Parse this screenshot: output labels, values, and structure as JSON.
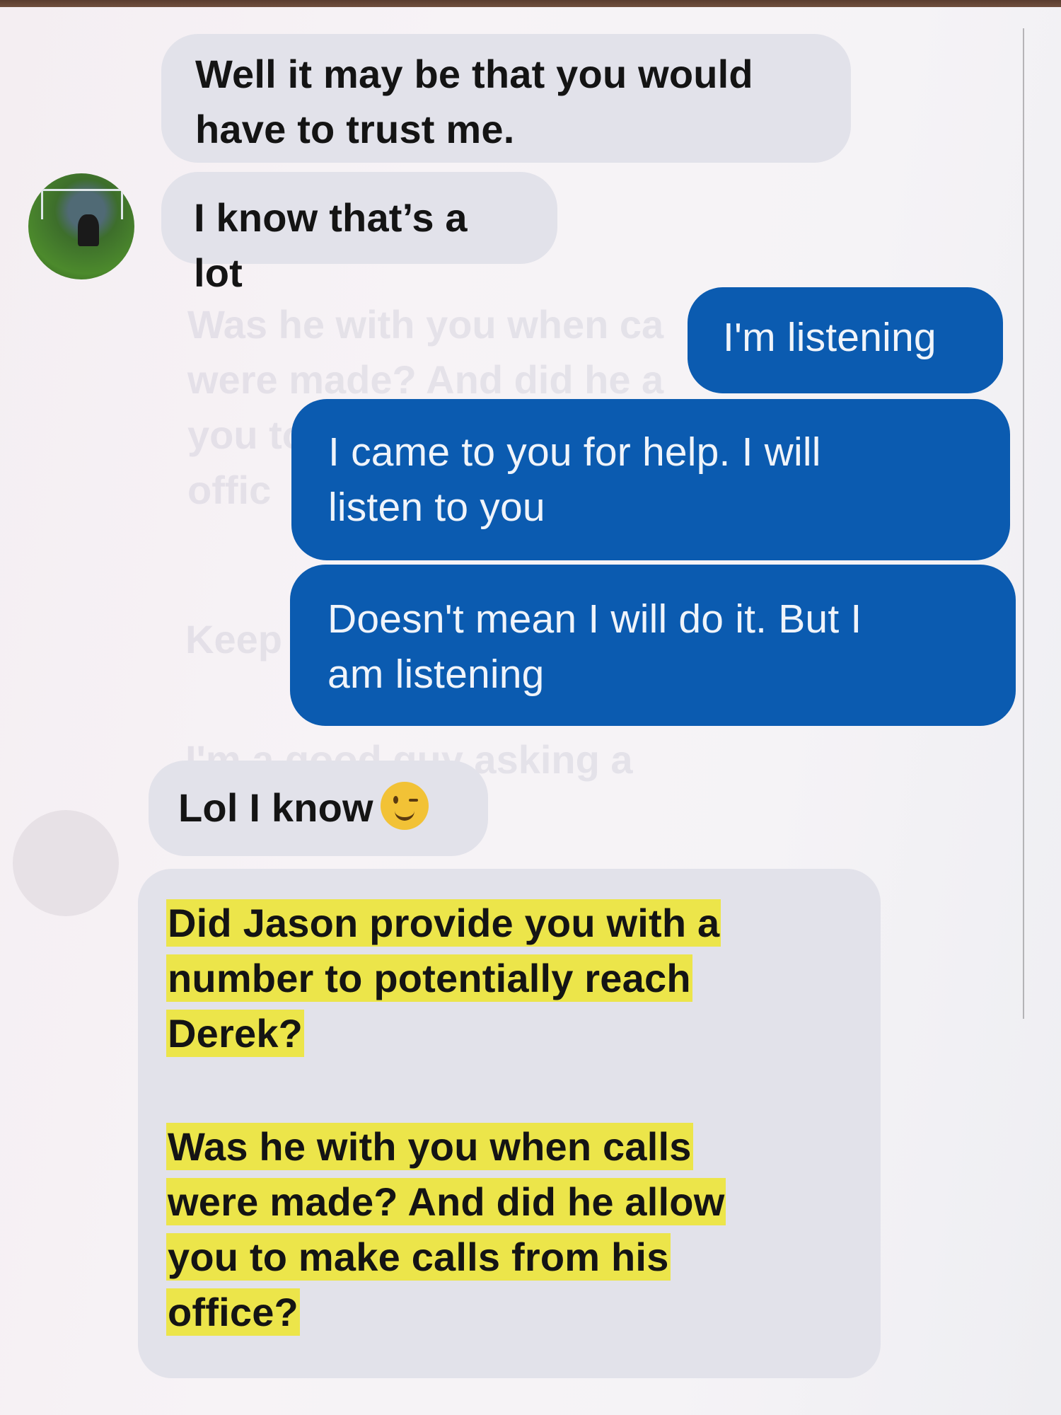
{
  "conversation": {
    "messages": [
      {
        "direction": "incoming",
        "lines": [
          "Well it may be that you would",
          "have to trust me."
        ]
      },
      {
        "direction": "incoming",
        "lines": [
          "I know that’s a lot"
        ]
      },
      {
        "direction": "outgoing",
        "lines": [
          "I'm listening"
        ]
      },
      {
        "direction": "outgoing",
        "lines": [
          "I came to you for help.  I will",
          "listen to you"
        ]
      },
      {
        "direction": "outgoing",
        "lines": [
          "Doesn't mean I will do it.  But I",
          "am listening"
        ]
      },
      {
        "direction": "incoming",
        "text": "Lol I know",
        "emoji": "winking-smile-emoji"
      },
      {
        "direction": "incoming",
        "highlighted": true,
        "highlight_color": "#ece54a",
        "paragraphs": [
          [
            "Did Jason provide you with a",
            "number to potentially reach",
            "Derek?"
          ],
          [
            "Was he with you when calls",
            "were made? And did he allow",
            "you to make calls from his",
            "office?"
          ]
        ]
      }
    ]
  },
  "colors": {
    "incoming_bubble": "#e2e2ea",
    "outgoing_bubble": "#0b5bb0",
    "highlight": "#ece54a"
  },
  "icons": {
    "contact_avatar": "avatar-soccer-photo",
    "emoji": "winking-smile-emoji"
  }
}
